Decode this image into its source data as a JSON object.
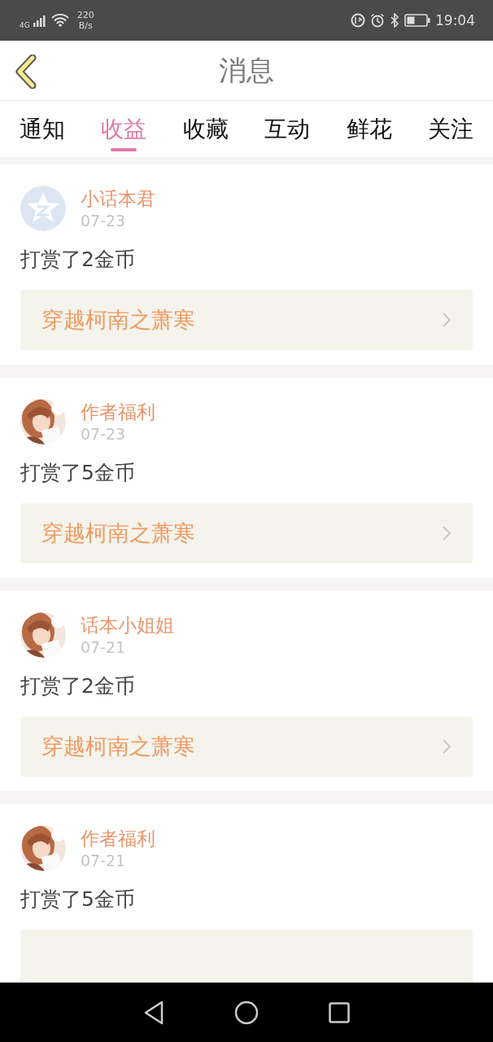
{
  "status_bar": {
    "network": "4G",
    "speed_value": "220",
    "speed_unit": "B/s",
    "time": "19:04"
  },
  "header": {
    "title": "消息"
  },
  "tabs": [
    {
      "label": "通知",
      "selected": false
    },
    {
      "label": "收益",
      "selected": true
    },
    {
      "label": "收藏",
      "selected": false
    },
    {
      "label": "互动",
      "selected": false
    },
    {
      "label": "鲜花",
      "selected": false
    },
    {
      "label": "关注",
      "selected": false
    }
  ],
  "messages": [
    {
      "avatar": {
        "kind": "default"
      },
      "name": "小话本君",
      "date": "07-23",
      "text": "打赏了2金币",
      "book": "穿越柯南之萧寒"
    },
    {
      "name": "作者福利",
      "date": "07-23",
      "text": "打赏了5金币",
      "book": "穿越柯南之萧寒"
    },
    {
      "name": "话本小姐姐",
      "date": "07-21",
      "text": "打赏了2金币",
      "book": "穿越柯南之萧寒"
    },
    {
      "name": "作者福利",
      "date": "07-21",
      "text": "打赏了5金币"
    }
  ]
}
